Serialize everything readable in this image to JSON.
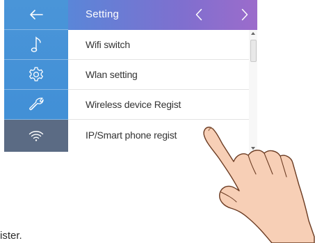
{
  "header": {
    "back_icon": "back-arrow-icon",
    "title": "Setting",
    "prev_icon": "chevron-left-icon",
    "next_icon": "chevron-right-icon",
    "gradient_start": "#5a86d8",
    "gradient_end": "#9c6ccb"
  },
  "sidebar": {
    "color": "#4a95d8",
    "active_color": "#5b6b84",
    "items": [
      {
        "icon": "music-note-icon"
      },
      {
        "icon": "gear-icon"
      },
      {
        "icon": "wrench-icon"
      },
      {
        "icon": "wifi-icon",
        "active": true
      }
    ]
  },
  "menu": {
    "items": [
      {
        "label": "Wifi switch"
      },
      {
        "label": "Wlan setting"
      },
      {
        "label": "Wireless device Regist"
      },
      {
        "label": "IP/Smart phone regist"
      }
    ]
  },
  "caption": {
    "text": "ister."
  },
  "illustration": {
    "icon": "pointing-hand"
  }
}
